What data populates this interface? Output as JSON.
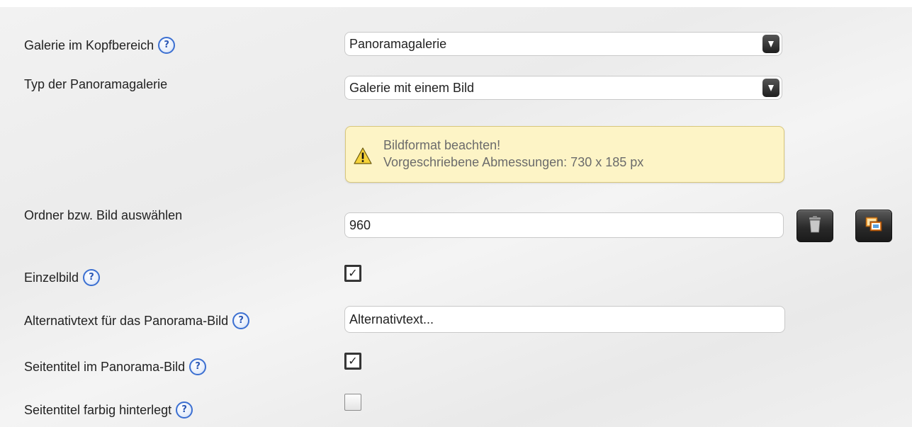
{
  "form": {
    "gallery_header": {
      "label": "Galerie im Kopfbereich",
      "help": "?",
      "value": "Panoramagalerie"
    },
    "panorama_type": {
      "label": "Typ der Panoramagalerie",
      "value": "Galerie mit einem Bild"
    },
    "warning": {
      "title": "Bildformat beachten!",
      "text": "Vorgeschriebene Abmessungen: 730 x 185 px",
      "icon": "warning-triangle-icon"
    },
    "folder": {
      "label": "Ordner bzw. Bild auswählen",
      "value": "960",
      "delete_icon": "trash-icon",
      "browse_icon": "image-folder-icon"
    },
    "single_image": {
      "label": "Einzelbild",
      "help": "?",
      "checked": true
    },
    "alt_text": {
      "label": "Alternativtext für das Panorama-Bild",
      "help": "?",
      "value": "Alternativtext..."
    },
    "page_title_in_image": {
      "label": "Seitentitel im Panorama-Bild",
      "help": "?",
      "checked": true
    },
    "page_title_colored": {
      "label": "Seitentitel farbig hinterlegt",
      "help": "?",
      "checked": false
    }
  },
  "colors": {
    "panel_background": "#eeeeee",
    "help_icon": "#3b6fd1",
    "warning_background": "#fdf4c6",
    "warning_border": "#d8c77c",
    "warning_text": "#6b6b6b",
    "dark_button": "#2a2a2a",
    "folder_icon_accent": "#e07a1f"
  }
}
